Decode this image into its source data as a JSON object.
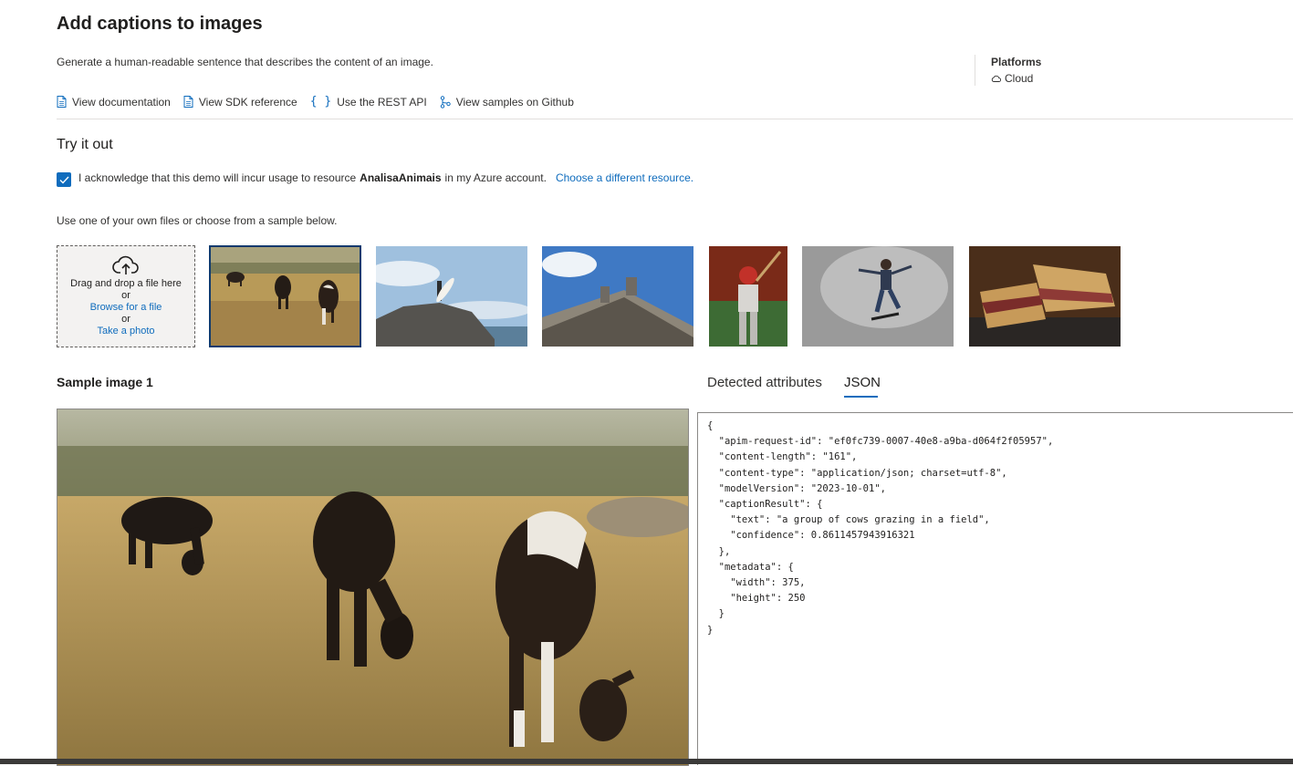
{
  "header": {
    "title": "Add captions to images",
    "description": "Generate a human-readable sentence that describes the content of an image.",
    "platforms_label": "Platforms",
    "platform_value": "Cloud"
  },
  "links": [
    {
      "label": "View documentation",
      "icon": "document-icon"
    },
    {
      "label": "View SDK reference",
      "icon": "document-icon"
    },
    {
      "label": "Use the REST API",
      "icon": "braces-icon"
    },
    {
      "label": "View samples on Github",
      "icon": "branch-icon"
    }
  ],
  "try": {
    "heading": "Try it out",
    "ack_prefix": "I acknowledge that this demo will incur usage to resource",
    "ack_resource": "AnalisaAnimais",
    "ack_suffix": "in my Azure account.",
    "ack_link": "Choose a different resource.",
    "ack_checked": true,
    "use_own": "Use one of your own files or choose from a sample below."
  },
  "upload": {
    "drag_text": "Drag and drop a file here",
    "or1": "or",
    "browse": "Browse for a file",
    "or2": "or",
    "photo": "Take a photo"
  },
  "samples": [
    {
      "subject": "cows-grazing",
      "selected": true
    },
    {
      "subject": "surfer-on-cliff",
      "selected": false
    },
    {
      "subject": "building-statues",
      "selected": false
    },
    {
      "subject": "baseball-batter",
      "selected": false
    },
    {
      "subject": "skateboarder",
      "selected": false
    },
    {
      "subject": "sandwich",
      "selected": false
    }
  ],
  "result": {
    "sample_title": "Sample image 1",
    "tabs": [
      "Detected attributes",
      "JSON"
    ],
    "active_tab": "JSON",
    "json_lines": [
      "{",
      "  \"apim-request-id\": \"ef0fc739-0007-40e8-a9ba-d064f2f05957\",",
      "  \"content-length\": \"161\",",
      "  \"content-type\": \"application/json; charset=utf-8\",",
      "  \"modelVersion\": \"2023-10-01\",",
      "  \"captionResult\": {",
      "    \"text\": \"a group of cows grazing in a field\",",
      "    \"confidence\": 0.8611457943916321",
      "  },",
      "  \"metadata\": {",
      "    \"width\": 375,",
      "    \"height\": 250",
      "  }",
      "}"
    ]
  },
  "colors": {
    "accent": "#0f6cbd",
    "selected_border": "#0f3a6e",
    "text": "#201f1e"
  }
}
